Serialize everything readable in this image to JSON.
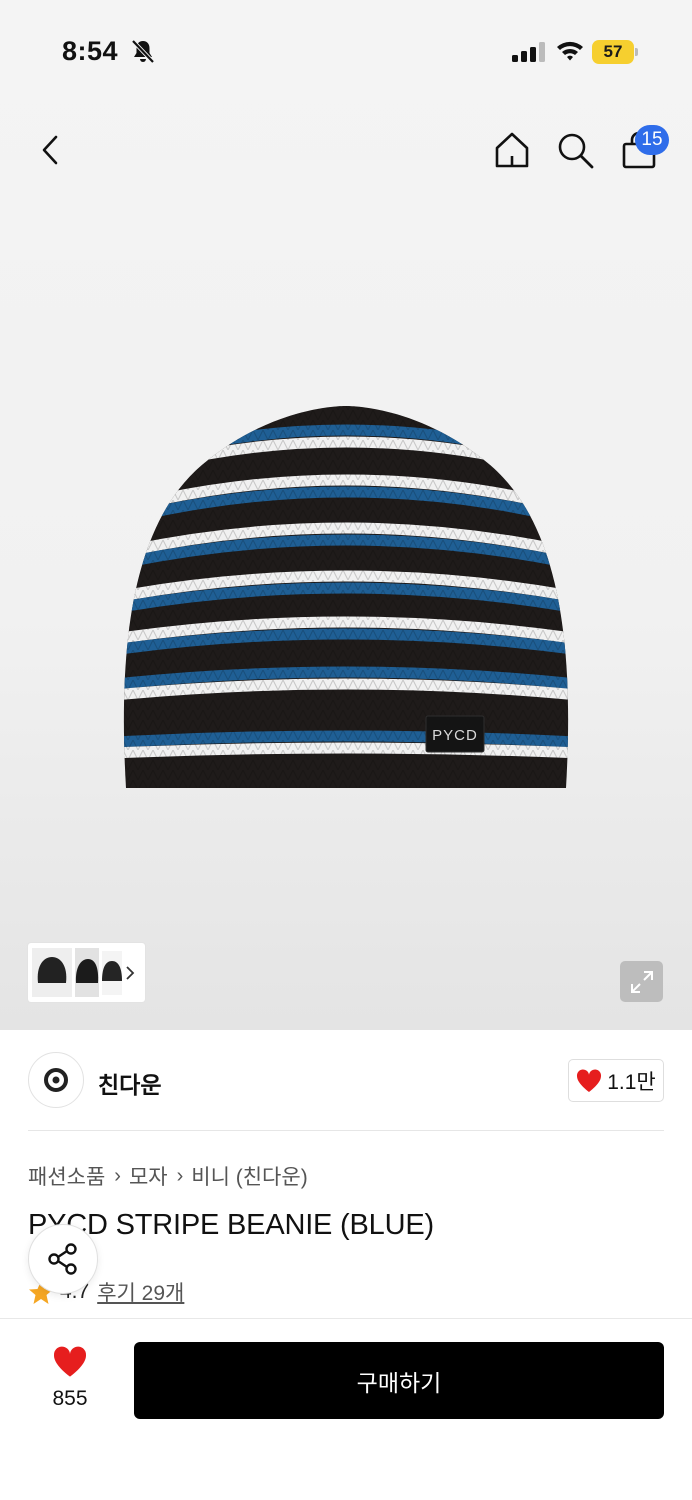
{
  "status_bar": {
    "time": "8:54",
    "battery": "57",
    "icons": [
      "bell-slash-icon",
      "cellular-signal-icon",
      "wifi-icon",
      "battery-icon"
    ]
  },
  "nav": {
    "icons": [
      "chevron-left-icon",
      "home-icon",
      "search-icon",
      "shopping-bag-icon"
    ],
    "cart_count": "15"
  },
  "product_image": {
    "label_text": "PYCD",
    "stripe_colors": [
      "#1f1b1a",
      "#f1f1f1",
      "#1f5f95"
    ]
  },
  "brand": {
    "name": "친다운",
    "likes": "1.1만"
  },
  "breadcrumb": [
    "패션소품",
    "모자",
    "비니 (친다운)"
  ],
  "product": {
    "title": "PYCD STRIPE BEANIE (BLUE)",
    "rating": "4.7",
    "reviews_label": "후기 29개"
  },
  "bottom_bar": {
    "wish_count": "855",
    "buy_label": "구매하기"
  },
  "colors": {
    "accent_badge": "#2f6dea",
    "heart": "#e61e1e",
    "star": "#f5a623",
    "buy_button": "#000000"
  }
}
